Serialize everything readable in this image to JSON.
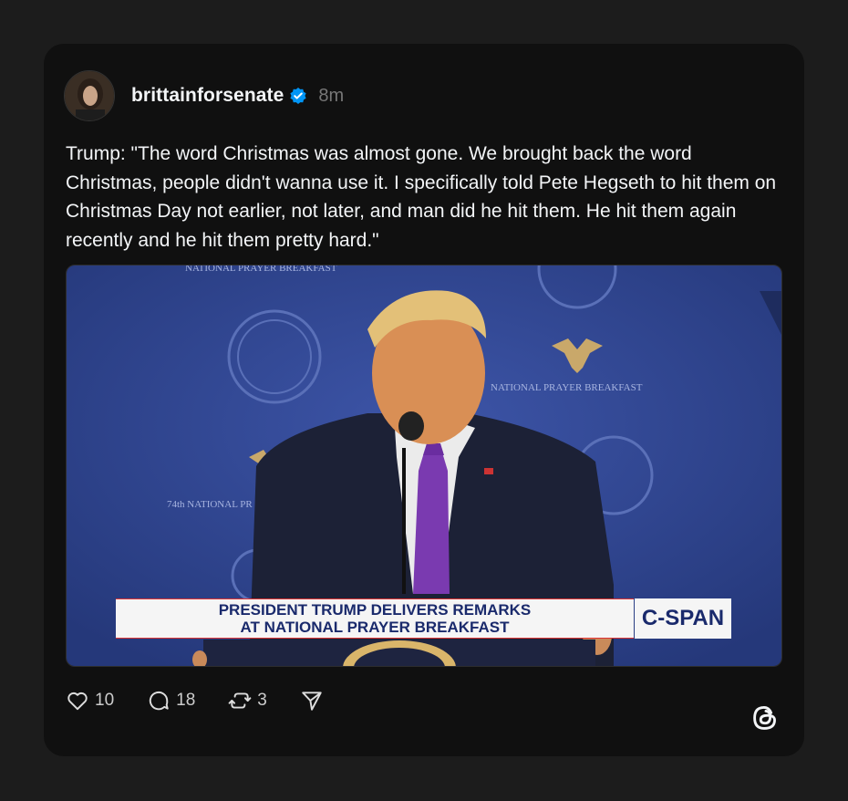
{
  "post": {
    "username": "brittainforsenate",
    "verified_icon": "verified-badge-icon",
    "time": "8m",
    "text": "Trump: \"The word Christmas was almost gone. We brought back the word Christmas, people didn't wanna use it. I specifically told Pete Hegseth to hit them on Christmas Day not earlier, not later, and man did he hit them. He hit them again recently and he hit them pretty hard.\""
  },
  "media": {
    "banner_line1": "PRESIDENT TRUMP DELIVERS REMARKS",
    "banner_line2": "AT NATIONAL PRAYER BREAKFAST",
    "network": "C-SPAN",
    "backdrop_text_right": "NATIONAL PRAYER BREAKFAST",
    "backdrop_text_left": "74th NATIONAL PR",
    "backdrop_text_top": "NATIONAL PRAYER BREAKFAST"
  },
  "actions": {
    "likes": "10",
    "replies": "18",
    "reposts": "3"
  },
  "colors": {
    "background": "#1c1c1c",
    "card": "#101010",
    "verified": "#0095f6",
    "text": "#f3f5f7",
    "muted": "#777777"
  }
}
